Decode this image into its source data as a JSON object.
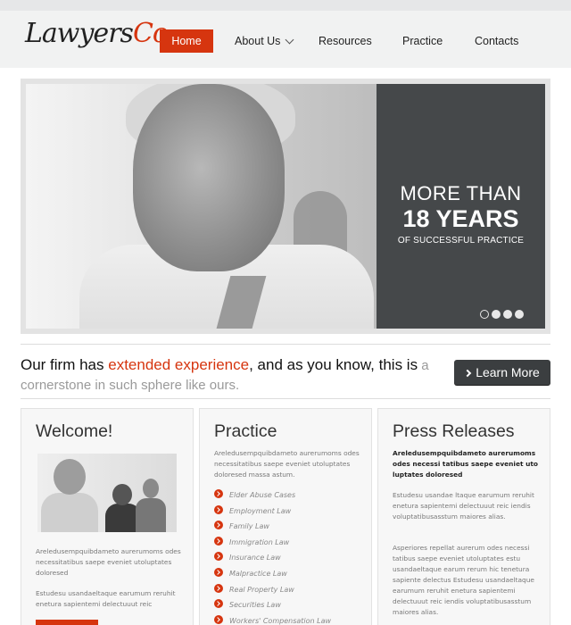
{
  "brand": {
    "logo_main": "Lawyers",
    "logo_accent": "Co"
  },
  "nav": {
    "items": [
      {
        "label": "Home",
        "active": true
      },
      {
        "label": "About Us",
        "dropdown": true
      },
      {
        "label": "Resources"
      },
      {
        "label": "Practice"
      },
      {
        "label": "Contacts"
      }
    ]
  },
  "hero": {
    "line1": "MORE THAN",
    "line2": "18 YEARS",
    "line3": "OF SUCCESSFUL PRACTICE",
    "slides": 4,
    "active_slide": 1
  },
  "tagline": {
    "part1": "Our firm has ",
    "highlight": "extended experience",
    "part2": ", and as you know, this is",
    "muted": " a cornerstone in such sphere like ours."
  },
  "cta": {
    "label": "Learn More"
  },
  "welcome": {
    "title": "Welcome!",
    "para1": "Areledusempquibdameto aurerumoms odes necessitatibus saepe eveniet utoluptates doloresed",
    "para2": "Estudesu usandaeltaque earumum reruhit enetura sapientemi delectuuut reic"
  },
  "practice": {
    "title": "Practice",
    "intro": "Areledusempquibdameto aurerumoms odes necessitatibus saepe eveniet utoluptates doloresed massa astum.",
    "items": [
      "Elder Abuse Cases",
      "Employment Law",
      "Family Law",
      "Immigration Law",
      "Insurance Law",
      "Malpractice Law",
      "Real Property Law",
      "Securities Law",
      "Workers' Compensation Law"
    ]
  },
  "press": {
    "title": "Press Releases",
    "lead": "Areledusempquibdameto aurerumoms odes necessi tatibus saepe eveniet uto luptates doloresed",
    "para1": "Estudesu usandae ltaque earumum reruhit enetura sapientemi delectuuut reic iendis voluptatibusasstum maiores alias.",
    "para2": "Asperiores repellat aurerum odes necessi tatibus saepe eveniet utoluptates estu usandaeltaque earum rerum hic tenetura sapiente delectus Estudesu usandaeltaque earumum reruhit enetura sapientemi delectuuut reic iendis voluptatibusasstum maiores alias."
  }
}
